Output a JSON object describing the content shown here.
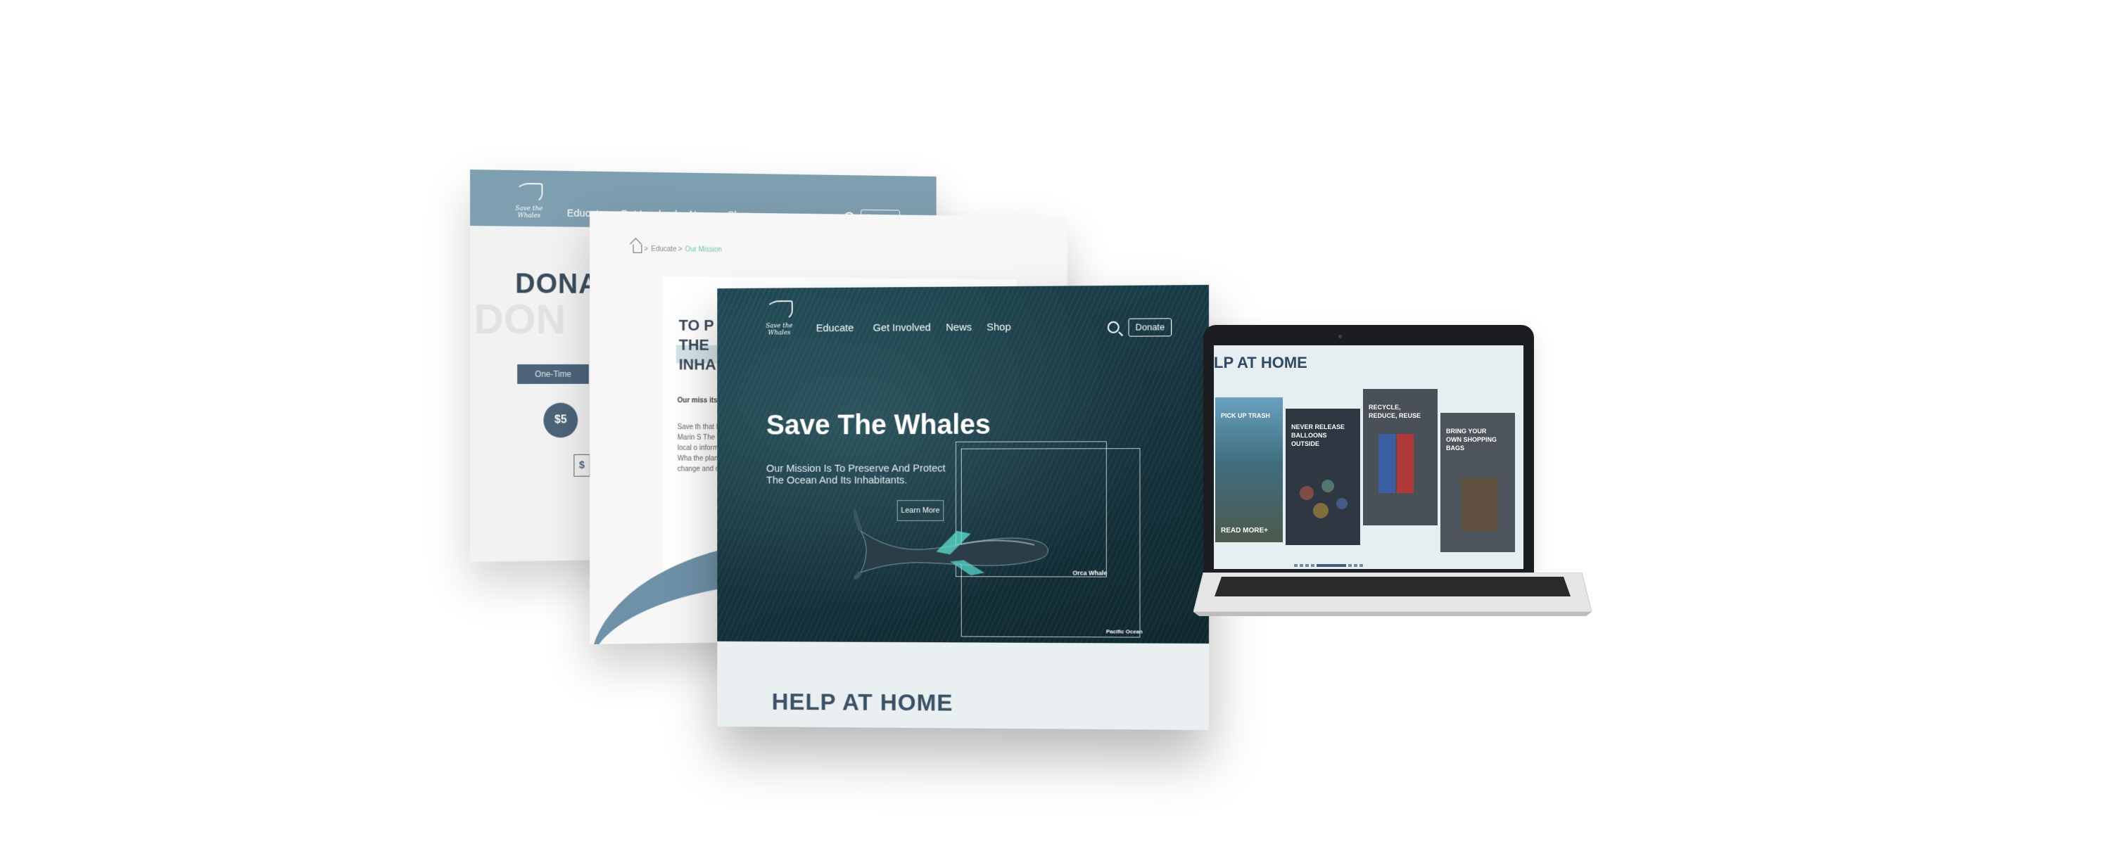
{
  "back_panel": {
    "logo_text": "Save the Whales",
    "nav": [
      "Educate",
      "Get Involved",
      "News",
      "Shop"
    ],
    "donate_label": "Donate",
    "title": "DONA",
    "ghost_title": "DON",
    "frequency_tab": "One-Time",
    "amount_circle": "$5",
    "amount_box": "$"
  },
  "middle_panel": {
    "breadcrumb": [
      "Educate",
      "Our Mission"
    ],
    "title": "TO P THE INHA",
    "lead": "Our miss its inhab",
    "body": "Save th that beg Marin S The Mar local o inform the Wha the plan change and ou"
  },
  "front_panel": {
    "logo_text": "Save the Whales",
    "nav": [
      "Educate",
      "Get Involved",
      "News",
      "Shop"
    ],
    "donate_label": "Donate",
    "hero_title": "Save The Whales",
    "hero_subtitle": "Our Mission Is To Preserve And Protect The Ocean And Its Inhabitants.",
    "learn_more": "Learn More",
    "frame_label_1": "Orca Whale",
    "frame_label_2": "Pacific Ocean",
    "section_title": "HELP AT HOME"
  },
  "laptop": {
    "section_title": "LP AT HOME",
    "cards": [
      {
        "label": "PICK UP TRASH",
        "cta": "READ  MORE+"
      },
      {
        "label": "NEVER RELEASE BALLOONS OUTSIDE"
      },
      {
        "label": "RECYCLE, REDUCE, REUSE"
      },
      {
        "label": "BRING YOUR OWN SHOPPING BAGS"
      }
    ]
  },
  "colors": {
    "nav_bg": "#7e9fb0",
    "dark_slate": "#4c6379",
    "ocean_dark": "#17343e",
    "accent_teal": "#73c6b6",
    "heading_navy": "#2f4a63"
  }
}
